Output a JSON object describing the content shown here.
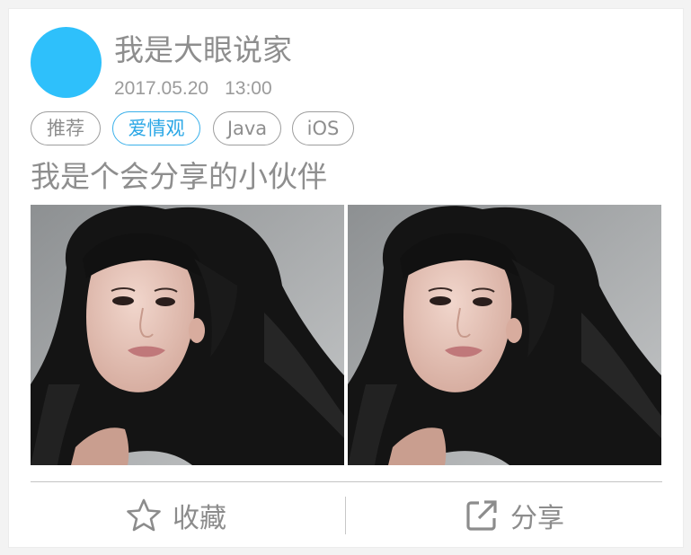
{
  "post": {
    "author_name": "我是大眼说家",
    "date": "2017.05.20",
    "time": "13:00",
    "avatar_color": "#2ec0fb",
    "tags": [
      {
        "label": "推荐",
        "active": false
      },
      {
        "label": "爱情观",
        "active": true
      },
      {
        "label": "Java",
        "active": false
      },
      {
        "label": "iOS",
        "active": false
      }
    ],
    "headline": "我是个会分享的小伙伴",
    "images": [
      {
        "subject": "portrait-woman-dark-hair"
      },
      {
        "subject": "portrait-woman-dark-hair"
      }
    ]
  },
  "actions": {
    "favorite_label": "收藏",
    "favorite_icon": "star-outline-icon",
    "share_label": "分享",
    "share_icon": "share-external-icon"
  },
  "colors": {
    "accent": "#2aa7e6",
    "text": "#8e8e8e",
    "border": "#9d9d9d"
  }
}
